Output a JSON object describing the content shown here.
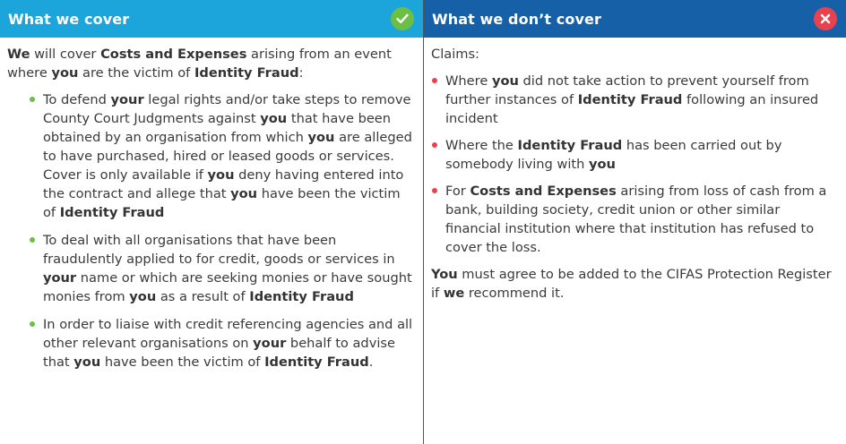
{
  "cover": {
    "title": "What we cover",
    "icon": "check-icon",
    "intro": [
      {
        "t": "We",
        "b": true
      },
      {
        "t": " will cover "
      },
      {
        "t": "Costs and Expenses",
        "b": true
      },
      {
        "t": " arising from an event where "
      },
      {
        "t": "you",
        "b": true
      },
      {
        "t": " are the victim of "
      },
      {
        "t": "Identity Fraud",
        "b": true
      },
      {
        "t": ":"
      }
    ],
    "items": [
      [
        {
          "t": "To defend "
        },
        {
          "t": "your",
          "b": true
        },
        {
          "t": " legal rights and/or take steps to remove County Court Judgments against "
        },
        {
          "t": "you",
          "b": true
        },
        {
          "t": " that have been obtained by an organisation from which "
        },
        {
          "t": "you",
          "b": true
        },
        {
          "t": " are alleged to have purchased, hired or leased goods or services. Cover is only available if "
        },
        {
          "t": "you",
          "b": true
        },
        {
          "t": " deny having entered into the contract and allege that "
        },
        {
          "t": "you",
          "b": true
        },
        {
          "t": " have been the victim of "
        },
        {
          "t": "Identity Fraud",
          "b": true
        }
      ],
      [
        {
          "t": "To deal with all organisations that have been fraudulently applied to for credit, goods or services in "
        },
        {
          "t": "your",
          "b": true
        },
        {
          "t": " name or which are seeking monies or have sought monies from "
        },
        {
          "t": "you",
          "b": true
        },
        {
          "t": " as a result of "
        },
        {
          "t": "Identity Fraud",
          "b": true
        }
      ],
      [
        {
          "t": "In order to liaise with credit referencing agencies and all other relevant organisations on "
        },
        {
          "t": "your",
          "b": true
        },
        {
          "t": " behalf to advise that "
        },
        {
          "t": "you",
          "b": true
        },
        {
          "t": " have been the victim of "
        },
        {
          "t": "Identity Fraud",
          "b": true
        },
        {
          "t": "."
        }
      ]
    ]
  },
  "not_cover": {
    "title": "What we don’t cover",
    "icon": "close-icon",
    "intro": [
      {
        "t": "Claims:"
      }
    ],
    "items": [
      [
        {
          "t": "Where "
        },
        {
          "t": "you",
          "b": true
        },
        {
          "t": " did not take action to prevent yourself from further instances of "
        },
        {
          "t": "Identity Fraud",
          "b": true
        },
        {
          "t": " following an insured incident"
        }
      ],
      [
        {
          "t": "Where the "
        },
        {
          "t": "Identity Fraud",
          "b": true
        },
        {
          "t": " has been carried out by somebody living with "
        },
        {
          "t": "you",
          "b": true
        }
      ],
      [
        {
          "t": "For "
        },
        {
          "t": "Costs and Expenses",
          "b": true
        },
        {
          "t": " arising from loss of cash from a bank, building society, credit union or other similar financial institution where that institution has refused to cover the loss."
        }
      ]
    ],
    "closing": [
      {
        "t": "You",
        "b": true
      },
      {
        "t": " must agree to be added to the CIFAS Protection Register if "
      },
      {
        "t": "we",
        "b": true
      },
      {
        "t": " recommend it."
      }
    ]
  },
  "colors": {
    "cover_header": "#1ba5da",
    "not_cover_header": "#1660a8",
    "check": "#6cbe45",
    "cross": "#e8424f"
  }
}
